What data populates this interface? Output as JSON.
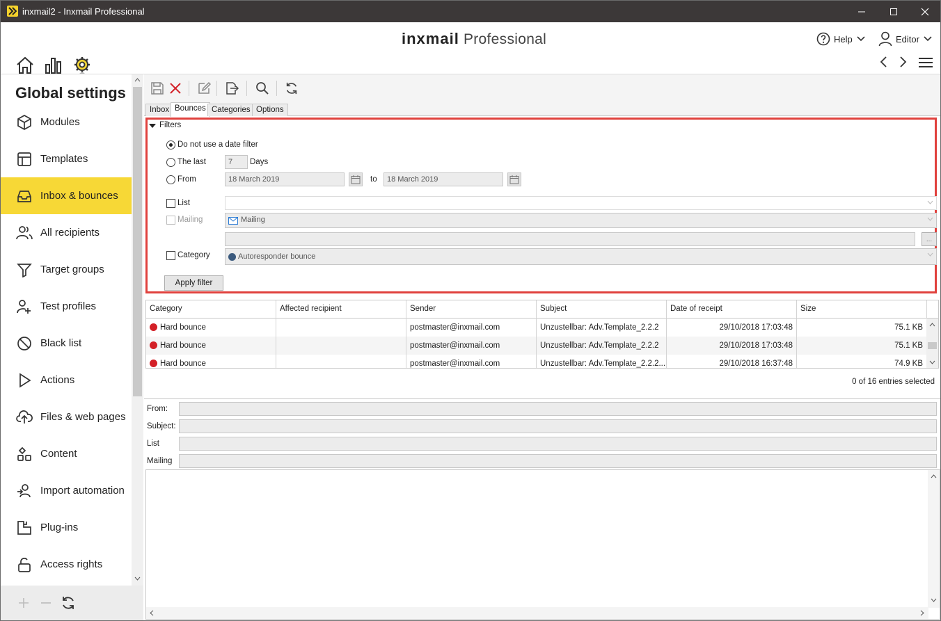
{
  "window": {
    "title": "inxmail2 - Inxmail Professional"
  },
  "header": {
    "brand_bold": "inxmail",
    "brand_light": "Professional",
    "help_label": "Help",
    "user_label": "Editor"
  },
  "sidebar": {
    "title": "Global settings",
    "items": [
      {
        "label": "Modules",
        "icon": "cube-icon"
      },
      {
        "label": "Templates",
        "icon": "template-icon"
      },
      {
        "label": "Inbox & bounces",
        "icon": "inbox-icon",
        "active": true
      },
      {
        "label": "All recipients",
        "icon": "users-icon"
      },
      {
        "label": "Target groups",
        "icon": "funnel-icon"
      },
      {
        "label": "Test profiles",
        "icon": "test-profile-icon"
      },
      {
        "label": "Black list",
        "icon": "block-icon"
      },
      {
        "label": "Actions",
        "icon": "play-icon"
      },
      {
        "label": "Files & web pages",
        "icon": "upload-cloud-icon"
      },
      {
        "label": "Content",
        "icon": "content-icon"
      },
      {
        "label": "Import automation",
        "icon": "import-user-icon"
      },
      {
        "label": "Plug-ins",
        "icon": "plugin-icon"
      },
      {
        "label": "Access rights",
        "icon": "lock-icon"
      }
    ]
  },
  "tabs": [
    {
      "label": "Inbox"
    },
    {
      "label": "Bounces",
      "active": true
    },
    {
      "label": "Categories"
    },
    {
      "label": "Options"
    }
  ],
  "filters": {
    "heading": "Filters",
    "no_date_label": "Do not use a date filter",
    "last_label": "The last",
    "last_value": "7",
    "days_label": "Days",
    "from_label": "From",
    "from_date": "18 March 2019",
    "to_label": "to",
    "to_date": "18 March 2019",
    "list_label": "List",
    "mailing_label": "Mailing",
    "mailing_value": "Mailing",
    "mailing_more": "...",
    "category_label": "Category",
    "category_value": "Autoresponder bounce",
    "apply_label": "Apply filter"
  },
  "table": {
    "columns": [
      "Category",
      "Affected recipient",
      "Sender",
      "Subject",
      "Date of receipt",
      "Size"
    ],
    "rows": [
      {
        "category": "Hard bounce",
        "recipient": "",
        "sender": "postmaster@inxmail.com",
        "subject": "Unzustellbar: Adv.Template_2.2.2",
        "date": "29/10/2018 17:03:48",
        "size": "75.1 KB"
      },
      {
        "category": "Hard bounce",
        "recipient": "",
        "sender": "postmaster@inxmail.com",
        "subject": "Unzustellbar: Adv.Template_2.2.2",
        "date": "29/10/2018 17:03:48",
        "size": "75.1 KB"
      },
      {
        "category": "Hard bounce",
        "recipient": "",
        "sender": "postmaster@inxmail.com",
        "subject": "Unzustellbar: Adv.Template_2.2.2...",
        "date": "29/10/2018 16:37:48",
        "size": "74.9 KB"
      }
    ],
    "selection_status": "0 of 16 entries selected"
  },
  "detail": {
    "from_label": "From:",
    "subject_label": "Subject:",
    "list_label": "List",
    "mailing_label": "Mailing"
  },
  "colors": {
    "accent": "#f7d836",
    "highlight_border": "#e0413d",
    "bounce_dot": "#d32027",
    "titlebar": "#3c3838"
  }
}
